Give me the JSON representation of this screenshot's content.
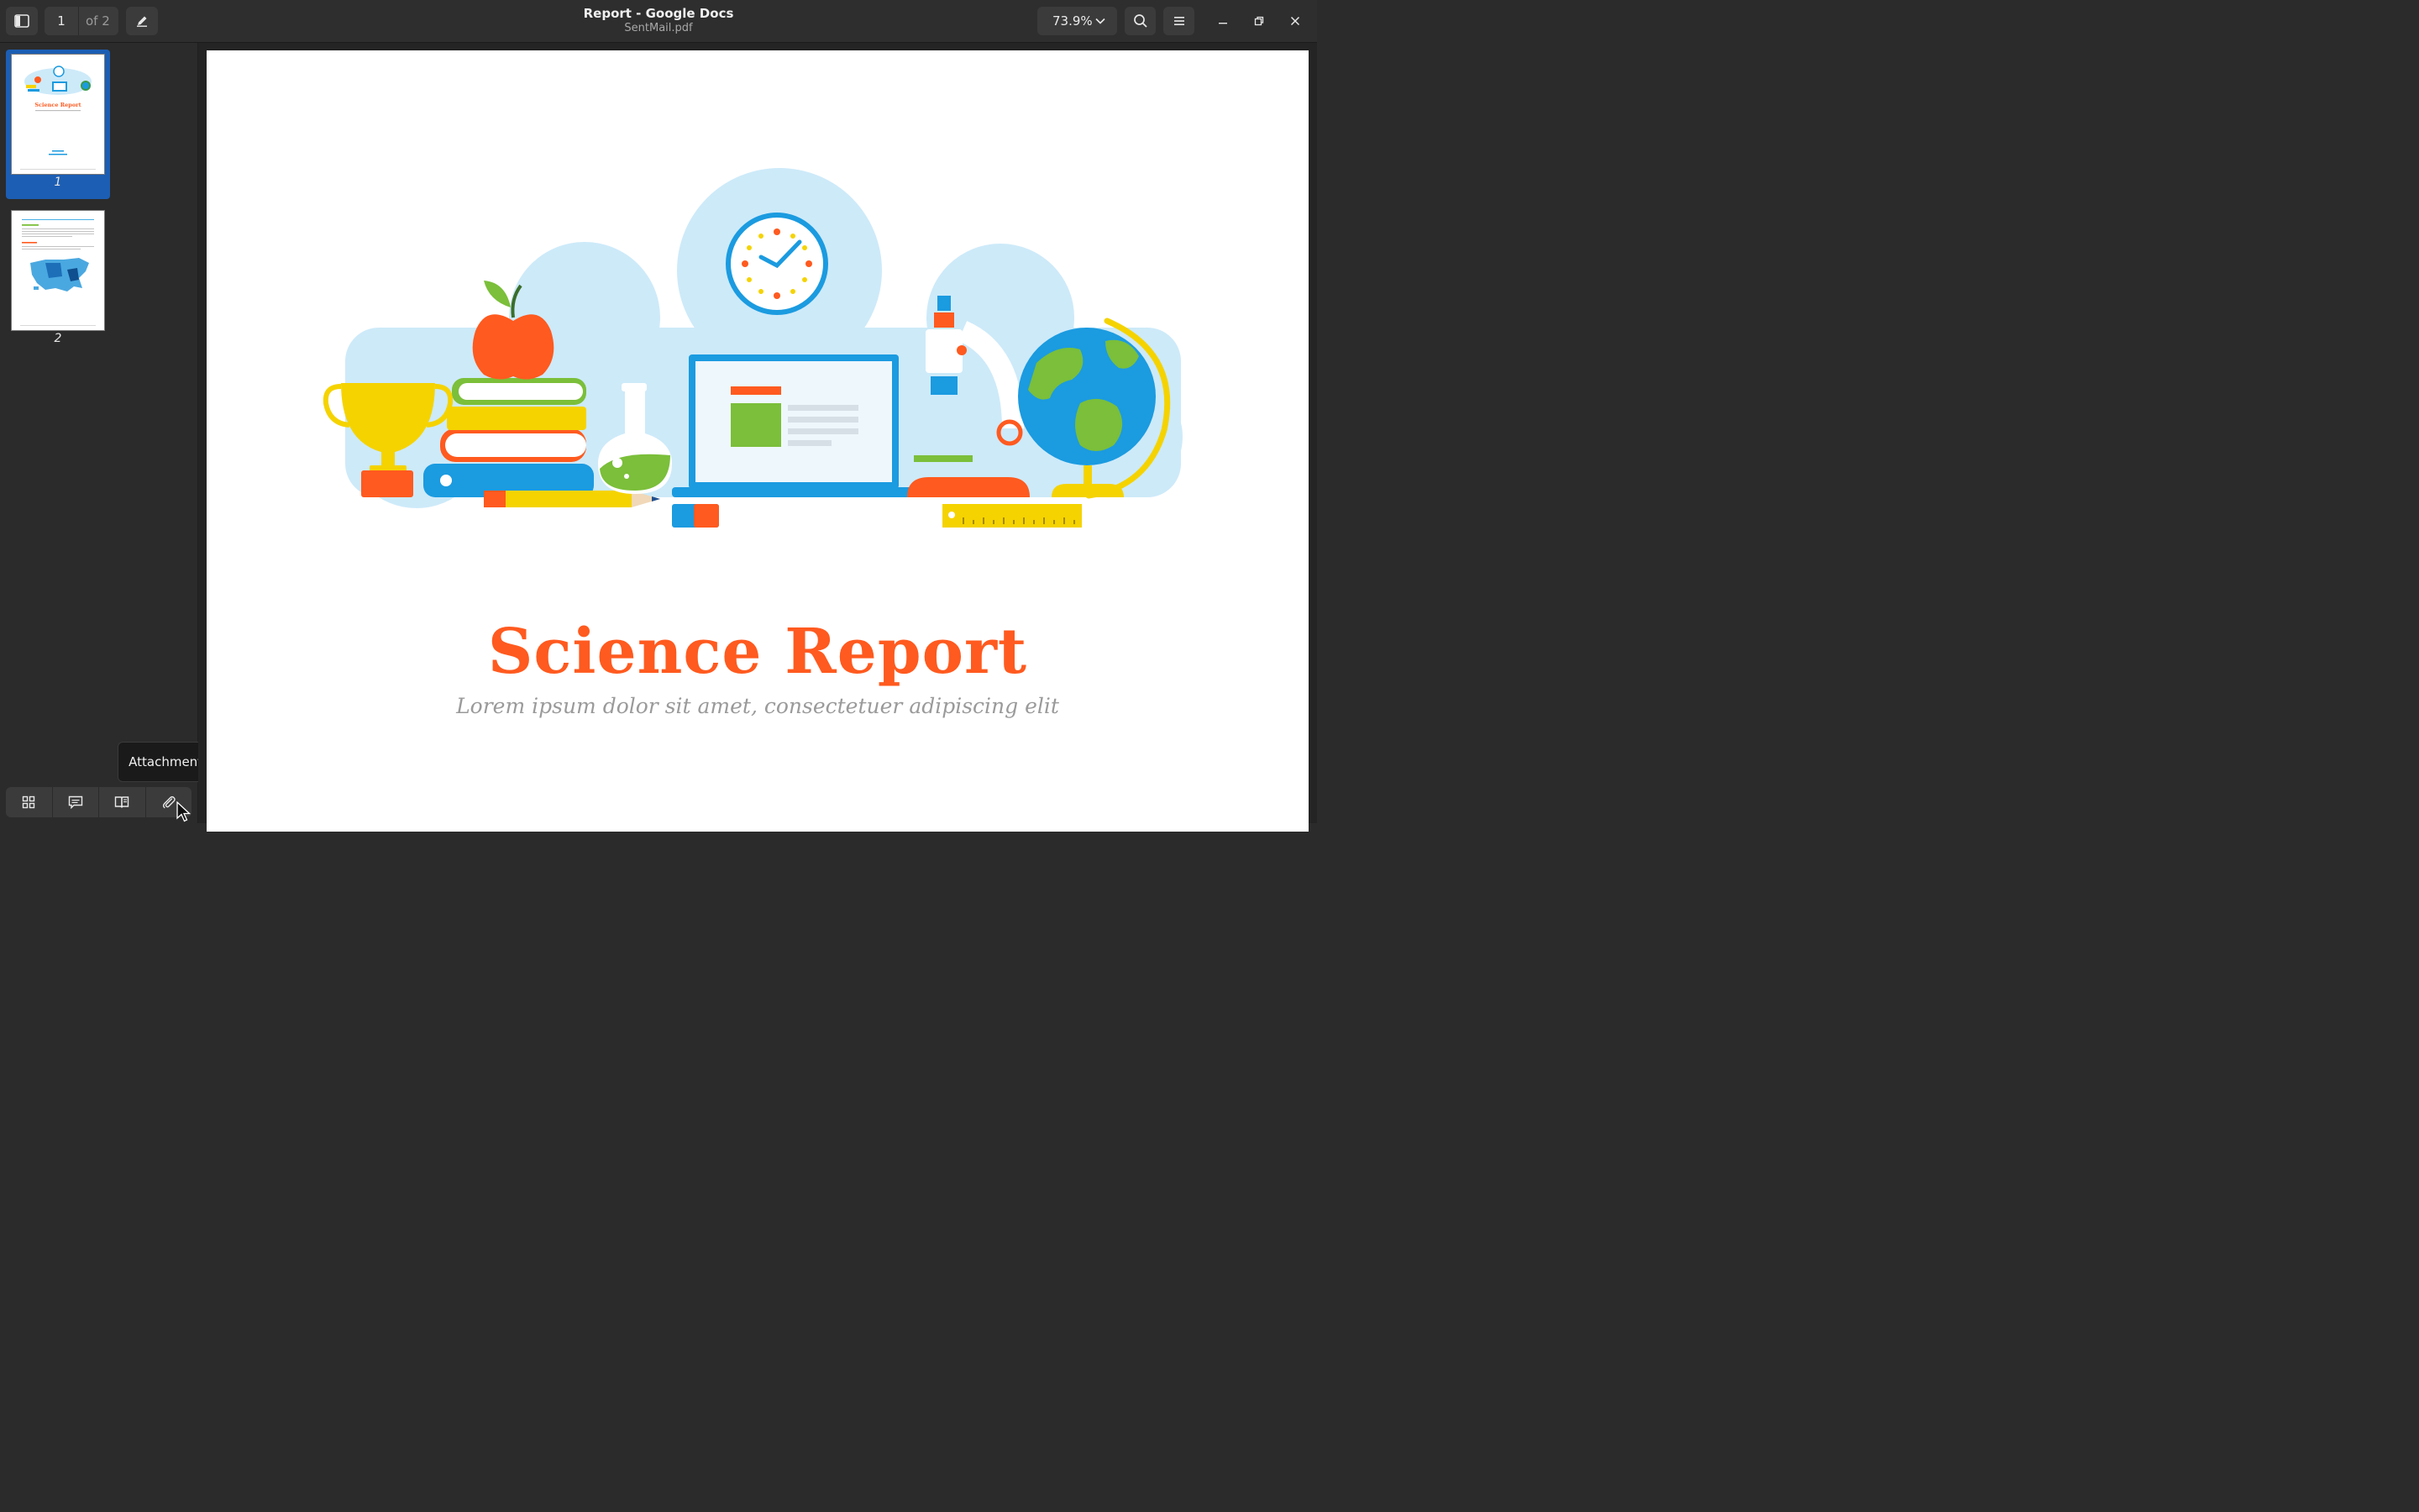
{
  "window": {
    "title": "Report - Google Docs",
    "subtitle": "SentMail.pdf"
  },
  "toolbar": {
    "page_current": "1",
    "page_total": "of 2",
    "zoom": "73.9%"
  },
  "sidebar": {
    "thumbnails": [
      {
        "label": "1",
        "selected": true
      },
      {
        "label": "2",
        "selected": false
      }
    ],
    "tooltip": "Attachments"
  },
  "document": {
    "title": "Science Report",
    "subtitle": "Lorem ipsum dolor sit amet, consectetuer adipiscing elit"
  },
  "colors": {
    "accent": "#ff5a1f",
    "selection": "#1c5eb4",
    "cloud": "#cdeaf9"
  }
}
